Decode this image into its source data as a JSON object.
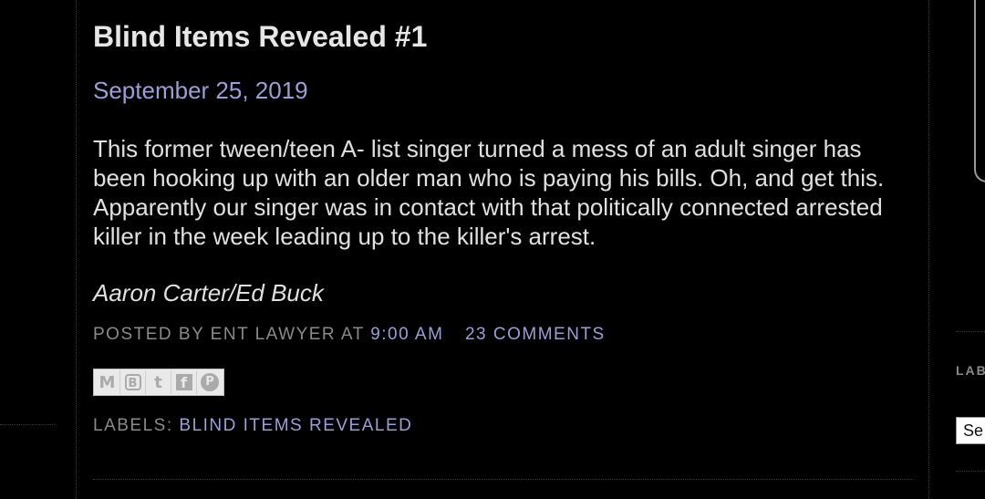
{
  "post": {
    "title": "Blind Items Revealed #1",
    "date": "September 25, 2019",
    "body": "This former tween/teen A- list singer turned a mess of an adult singer has been hooking up with an older man who is paying his bills. Oh, and get this. Apparently our singer was in contact with that politically connected arrested killer in the week leading up to the killer's arrest.",
    "reveal": "Aaron Carter/Ed Buck",
    "footer": {
      "posted_by_prefix": "POSTED BY ENT LAWYER AT",
      "time": "9:00 AM",
      "comments": "23 COMMENTS"
    },
    "labels": {
      "prefix": "LABELS:",
      "label": "BLIND ITEMS REVEALED"
    }
  },
  "share": {
    "email_glyph": "M",
    "blog_glyph": "B",
    "twitter_glyph": "t",
    "facebook_glyph": "f",
    "pinterest_glyph": "P"
  },
  "sidebar": {
    "heading": "LAB",
    "select_value": "Se"
  },
  "colors": {
    "background": "#000000",
    "link": "#9a9fd6",
    "muted": "#8a8a8a",
    "text": "#e0e0e0"
  }
}
